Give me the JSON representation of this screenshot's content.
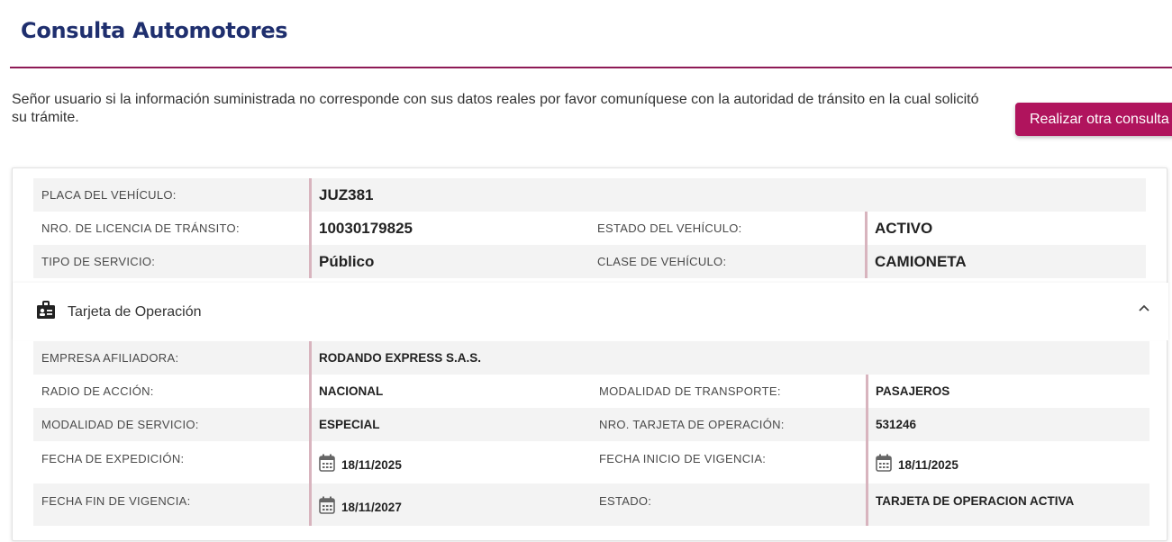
{
  "header": {
    "title": "Consulta Automotores"
  },
  "notice": {
    "text": "Señor usuario si la información suministrada no corresponde con sus datos reales por favor comuníquese con la autoridad de tránsito en la cual solicitó su trámite."
  },
  "actions": {
    "new_query_label": "Realizar otra consulta"
  },
  "vehicle": {
    "plate_label": "PLACA DEL VEHÍCULO:",
    "plate_value": "JUZ381",
    "license_label": "NRO. DE LICENCIA DE TRÁNSITO:",
    "license_value": "10030179825",
    "status_label": "ESTADO DEL VEHÍCULO:",
    "status_value": "ACTIVO",
    "service_type_label": "TIPO DE SERVICIO:",
    "service_type_value": "Público",
    "class_label": "CLASE DE VEHÍCULO:",
    "class_value": "CAMIONETA"
  },
  "operation_card": {
    "section_title": "Tarjeta de Operación",
    "icon": "briefcase-icon",
    "toggle_icon": "chevron-up-icon",
    "company_label": "EMPRESA AFILIADORA:",
    "company_value": "RODANDO EXPRESS S.A.S.",
    "radius_label": "RADIO DE ACCIÓN:",
    "radius_value": "NACIONAL",
    "transport_mode_label": "MODALIDAD DE TRANSPORTE:",
    "transport_mode_value": "PASAJEROS",
    "service_mode_label": "MODALIDAD DE SERVICIO:",
    "service_mode_value": "ESPECIAL",
    "card_number_label": "NRO. TARJETA DE OPERACIÓN:",
    "card_number_value": "531246",
    "issue_date_label": "FECHA DE EXPEDICIÓN:",
    "issue_date_value": "18/11/2025",
    "validity_start_label": "FECHA INICIO DE VIGENCIA:",
    "validity_start_value": "18/11/2025",
    "validity_end_label": "FECHA FIN DE VIGENCIA:",
    "validity_end_value": "18/11/2027",
    "state_label": "ESTADO:",
    "state_value": "TARJETA DE OPERACION ACTIVA"
  },
  "colors": {
    "title": "#1f2f6e",
    "accent": "#b0145d",
    "rule": "#8e1a55",
    "value_border": "#d8b4be",
    "row_grey": "#f3f3f3"
  }
}
